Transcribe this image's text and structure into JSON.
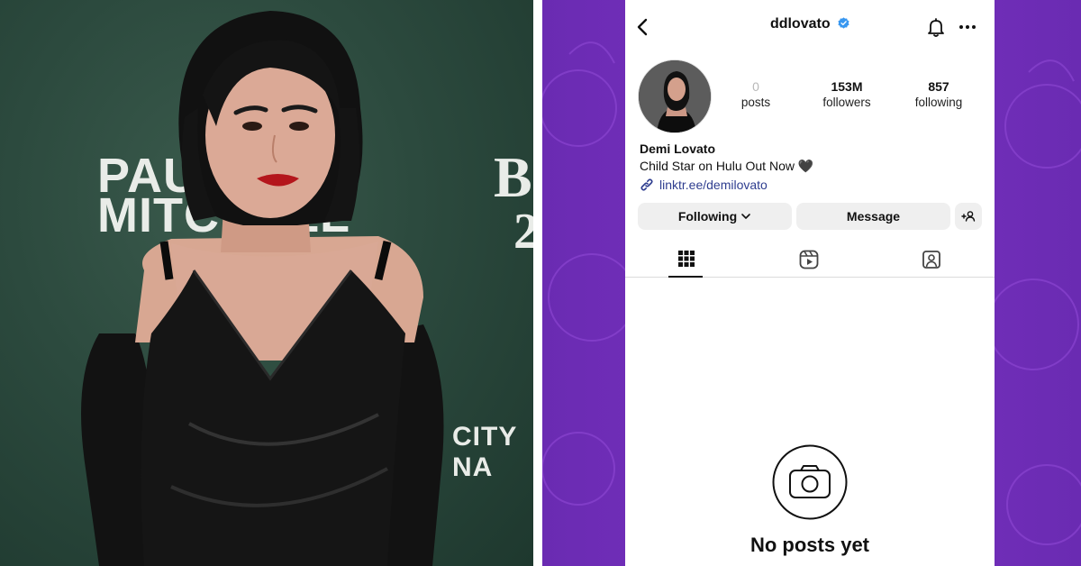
{
  "photo": {
    "backdrop_words": [
      "PAUL",
      "MITCHELL",
      "B",
      "2",
      "CITY NA",
      "B"
    ]
  },
  "profile": {
    "username": "ddlovato",
    "verified": true,
    "stats": {
      "posts_count": "0",
      "posts_label": "posts",
      "followers_count": "153M",
      "followers_label": "followers",
      "following_count": "857",
      "following_label": "following"
    },
    "display_name": "Demi Lovato",
    "bio": "Child Star on Hulu Out Now 🖤",
    "link": "linktr.ee/demilovato"
  },
  "actions": {
    "following_label": "Following",
    "message_label": "Message"
  },
  "tabs": [
    {
      "name": "grid",
      "icon": "grid-icon",
      "active": true
    },
    {
      "name": "reels",
      "icon": "reels-icon",
      "active": false
    },
    {
      "name": "tagged",
      "icon": "tagged-icon",
      "active": false
    }
  ],
  "empty_state": {
    "icon": "camera-icon",
    "title": "No posts yet"
  },
  "colors": {
    "backdrop_green": "#2c4a3e",
    "purple_bg": "#7a32c2",
    "verified_blue": "#3897f0",
    "link_blue": "#2e3d8f",
    "button_gray": "#efefef"
  }
}
